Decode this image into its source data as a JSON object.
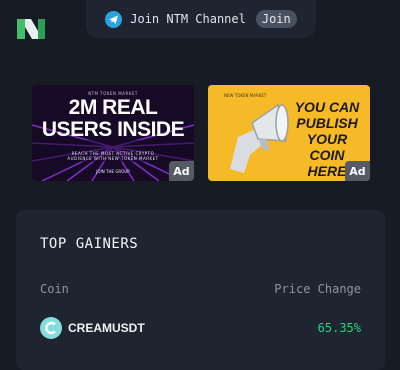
{
  "header": {
    "logo_icon": "ntm-logo-icon",
    "channel_icon": "telegram-icon",
    "channel_text": "Join NTM Channel",
    "join_label": "Join"
  },
  "ads": [
    {
      "top_text": "NTM TOKEN MARKET",
      "headline": [
        "2M REAL",
        "USERS INSIDE"
      ],
      "subtext": "REACH THE MOST ACTIVE CRYPTO AUDIENCE WITH NEW TOKEN MARKET",
      "cta": "JOIN THE GROUP",
      "badge": "Ad",
      "colors": {
        "bg": "#160a26",
        "accent": "#8b3dff"
      }
    },
    {
      "brand": "NEW TOKEN MARKET",
      "headline": [
        "YOU CAN",
        "PUBLISH",
        "YOUR COIN",
        "HERE"
      ],
      "badge": "Ad",
      "colors": {
        "bg": "#f6b928"
      }
    }
  ],
  "top_gainers": {
    "title": "TOP GAINERS",
    "columns": {
      "coin": "Coin",
      "change": "Price Change"
    },
    "rows": [
      {
        "coin": "CREAMUSDT",
        "change": "65.35%",
        "icon": "cream-coin-icon"
      }
    ]
  },
  "colors": {
    "background": "#161b24",
    "panel": "#1e2430",
    "positive": "#2fd17a",
    "telegram": "#2aa3de"
  }
}
